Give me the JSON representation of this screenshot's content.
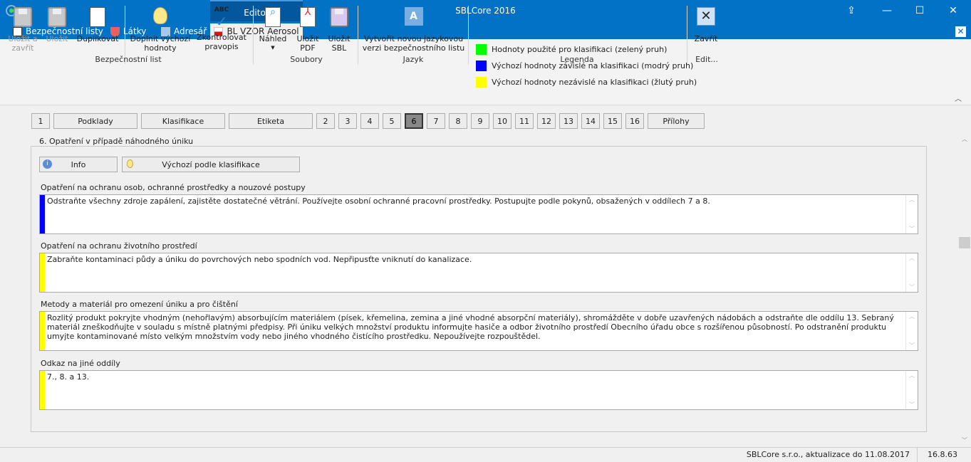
{
  "window": {
    "title": "SBLCore 2016",
    "context_tab": "Editor"
  },
  "tabs": [
    {
      "label": "Bezpečnostní listy"
    },
    {
      "label": "Látky"
    },
    {
      "label": "Adresář"
    },
    {
      "label": "BL VZOR Aerosol",
      "active": true
    }
  ],
  "ribbon": {
    "groups": {
      "bl": "Bezpečnostní list",
      "soubory": "Soubory",
      "jazyk": "Jazyk",
      "legenda": "Legenda",
      "edit": "Edit..."
    },
    "save_close": [
      "Uložit a",
      "zavřít"
    ],
    "save": "Uložit",
    "duplicate": "Duplikovat",
    "fill_defaults": [
      "Doplnit výchozí",
      "hodnoty"
    ],
    "spellcheck": [
      "Zkontrolovat",
      "pravopis"
    ],
    "spell_icon_text": "ABC",
    "preview": "Náhled",
    "save_pdf": [
      "Uložit",
      "PDF"
    ],
    "save_sbl": [
      "Uložit",
      "SBL"
    ],
    "new_lang": [
      "Vytvořit novou jazykovou",
      "verzi bezpečnostního listu"
    ],
    "legend": [
      {
        "color": "#00ff00",
        "label": "Hodnoty použité pro klasifikaci (zelený pruh)"
      },
      {
        "color": "#0000ff",
        "label": "Výchozí hodnoty závislé na klasifikaci (modrý pruh)"
      },
      {
        "color": "#ffff00",
        "label": "Výchozí hodnoty nezávislé na klasifikaci (žlutý pruh)"
      }
    ],
    "close": "Zavřít"
  },
  "nav": [
    "1",
    "Podklady",
    "Klasifikace",
    "Etiketa",
    "2",
    "3",
    "4",
    "5",
    "6",
    "7",
    "8",
    "9",
    "10",
    "11",
    "12",
    "13",
    "14",
    "15",
    "16",
    "Přílohy"
  ],
  "nav_selected": "6",
  "section": {
    "title": "6. Opatření v případě náhodného úniku",
    "info": "Info",
    "defaults": "Výchozí podle klasifikace",
    "fields": [
      {
        "label": "Opatření na ochranu osob, ochranné prostředky a nouzové postupy",
        "stripe": "#0000ff",
        "value": "Odstraňte všechny zdroje zapálení, zajistěte dostatečné větrání. Používejte osobní ochranné pracovní prostředky. Postupujte podle pokynů, obsažených v oddílech 7 a 8."
      },
      {
        "label": "Opatření na ochranu životního prostředí",
        "stripe": "#ffff00",
        "value": "Zabraňte kontaminaci půdy a úniku do povrchových nebo spodních vod. Nepřipusťte vniknutí do kanalizace."
      },
      {
        "label": "Metody a materiál pro omezení úniku a pro čištění",
        "stripe": "#ffff00",
        "value": "Rozlitý produkt pokryjte vhodným (nehořlavým) absorbujícím materiálem (písek, křemelina, zemina a jiné vhodné absorpční materiály), shromážděte v dobře uzavřených nádobách a odstraňte dle oddílu 13. Sebraný materiál zneškodňujte v souladu s místně platnými předpisy. Při úniku velkých množství produktu informujte hasiče a odbor životního prostředí Obecního úřadu obce s rozšířenou působností. Po odstranění produktu umyjte kontaminované místo velkým množstvím vody nebo jiného vhodného čistícího prostředku. Nepoužívejte rozpouštědel."
      },
      {
        "label": "Odkaz na jiné oddíly",
        "stripe": "#ffff00",
        "value": "7., 8. a 13."
      }
    ]
  },
  "status": {
    "company": "SBLCore s.r.o., aktualizace do 11.08.2017",
    "version": "16.8.63"
  }
}
